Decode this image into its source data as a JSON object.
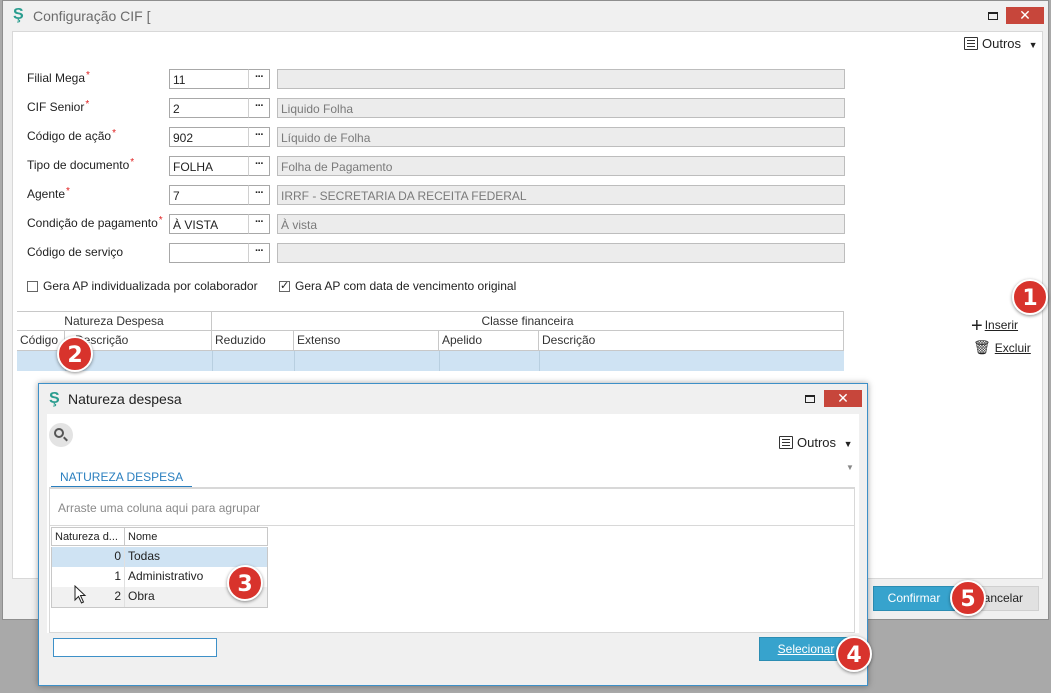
{
  "main": {
    "title": "Configuração CIF [",
    "close": "✕",
    "outros": "Outros",
    "fields": [
      {
        "label": "Filial Mega",
        "required": true,
        "code": "11",
        "desc": ""
      },
      {
        "label": "CIF Senior",
        "required": true,
        "code": "2",
        "desc": "Liquido Folha"
      },
      {
        "label": "Código de ação",
        "required": true,
        "code": "902",
        "desc": "Líquido de Folha"
      },
      {
        "label": "Tipo de documento",
        "required": true,
        "code": "FOLHA",
        "desc": "Folha de Pagamento"
      },
      {
        "label": "Agente",
        "required": true,
        "code": "7",
        "desc": "IRRF - SECRETARIA DA RECEITA FEDERAL"
      },
      {
        "label": "Condição de pagamento",
        "required": true,
        "code": "À VISTA",
        "desc": "À vista"
      },
      {
        "label": "Código de serviço",
        "required": false,
        "code": "",
        "desc": ""
      }
    ],
    "checkboxes": [
      {
        "label": "Gera AP individualizada por colaborador",
        "checked": false
      },
      {
        "label": "Gera AP com data de vencimento original",
        "checked": true
      }
    ],
    "grid": {
      "group_natureza": "Natureza Despesa",
      "group_classe": "Classe financeira",
      "columns": [
        "Código",
        "Descrição",
        "Reduzido",
        "Extenso",
        "Apelido",
        "Descrição"
      ]
    },
    "side": {
      "insert": "Inserir",
      "delete": "Excluir"
    },
    "confirm": "Confirmar",
    "cancel": "Cancelar",
    "required_mark": "*",
    "dots": "···"
  },
  "dialog": {
    "title": "Natureza despesa",
    "outros": "Outros",
    "tab": "NATUREZA DESPESA",
    "group_hint": "Arraste uma coluna aqui para agrupar",
    "columns": [
      "Natureza d...",
      "Nome"
    ],
    "rows": [
      {
        "code": "0",
        "name": "Todas"
      },
      {
        "code": "1",
        "name": "Administrativo"
      },
      {
        "code": "2",
        "name": "Obra"
      }
    ],
    "select": "Selecionar",
    "search_value": ""
  },
  "badges": [
    "1",
    "2",
    "3",
    "4",
    "5"
  ],
  "colors": {
    "accent": "#37a3cd",
    "close": "#c7463b",
    "badge": "#d8332c",
    "selected_row": "#cfe3f3"
  }
}
